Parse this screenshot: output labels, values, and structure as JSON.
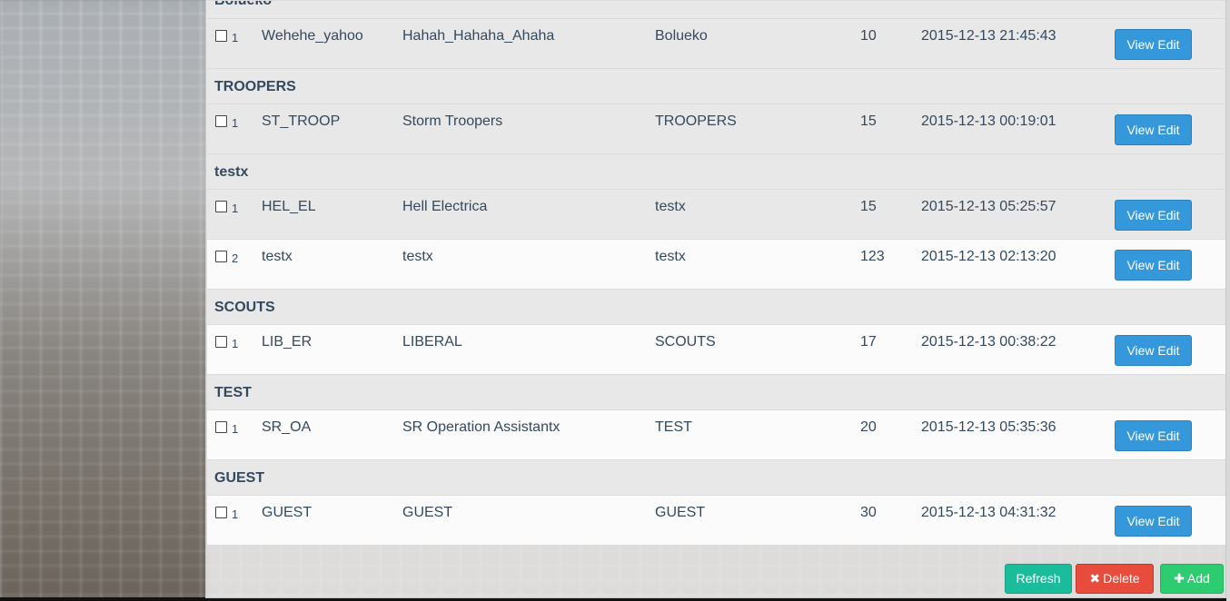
{
  "groups": [
    {
      "name": "Bolueko",
      "rows": [
        {
          "idx": "1",
          "code": "Wehehe_yahoo",
          "name": "Hahah_Hahaha_Ahaha",
          "group": "Bolueko",
          "num": "10",
          "date": "2015-12-13 21:45:43"
        }
      ]
    },
    {
      "name": "TROOPERS",
      "rows": [
        {
          "idx": "1",
          "code": "ST_TROOP",
          "name": "Storm Troopers",
          "group": "TROOPERS",
          "num": "15",
          "date": "2015-12-13 00:19:01"
        }
      ]
    },
    {
      "name": "testx",
      "rows": [
        {
          "idx": "1",
          "code": "HEL_EL",
          "name": "Hell Electrica",
          "group": "testx",
          "num": "15",
          "date": "2015-12-13 05:25:57"
        },
        {
          "idx": "2",
          "code": "testx",
          "name": "testx",
          "group": "testx",
          "num": "123",
          "date": "2015-12-13 02:13:20"
        }
      ]
    },
    {
      "name": "SCOUTS",
      "rows": [
        {
          "idx": "1",
          "code": "LIB_ER",
          "name": "LIBERAL",
          "group": "SCOUTS",
          "num": "17",
          "date": "2015-12-13 00:38:22"
        }
      ]
    },
    {
      "name": "TEST",
      "rows": [
        {
          "idx": "1",
          "code": "SR_OA",
          "name": "SR Operation Assistantx",
          "group": "TEST",
          "num": "20",
          "date": "2015-12-13 05:35:36"
        }
      ]
    },
    {
      "name": "GUEST",
      "rows": [
        {
          "idx": "1",
          "code": "GUEST",
          "name": "GUEST",
          "group": "GUEST",
          "num": "30",
          "date": "2015-12-13 04:31:32"
        }
      ]
    }
  ],
  "row_button": {
    "label": "View Edit"
  },
  "footer": {
    "refresh_label": "Refresh",
    "delete_label": "Delete",
    "add_label": "Add",
    "delete_icon": "x-icon",
    "add_icon": "plus-icon"
  },
  "colors": {
    "primary": "#3498db",
    "success": "#1abc9c",
    "danger": "#e74c3c",
    "add": "#2ecc71"
  }
}
